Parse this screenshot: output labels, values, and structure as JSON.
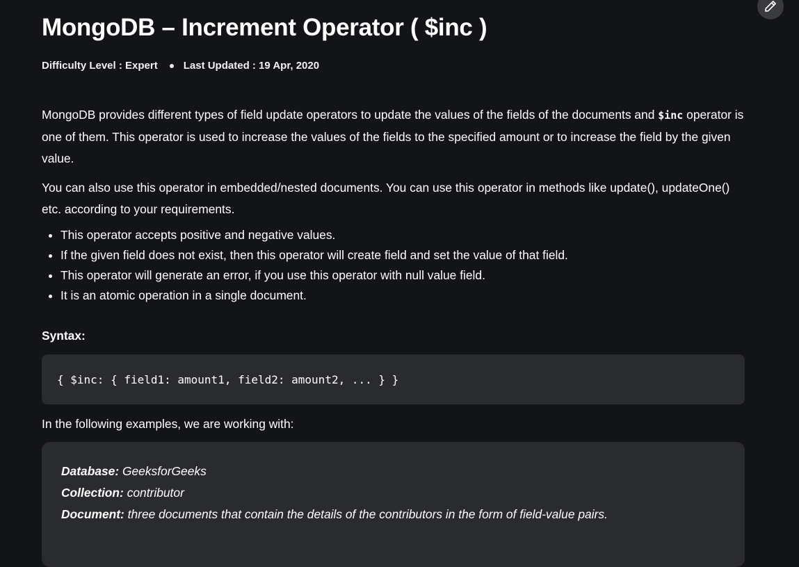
{
  "article": {
    "title": "MongoDB – Increment Operator ( $inc )",
    "difficulty": "Difficulty Level : Expert",
    "last_updated": "Last Updated : 19 Apr, 2020",
    "intro_before_code": "MongoDB provides different types of field update operators to update the values of the fields of the documents and ",
    "intro_code": "$inc",
    "intro_after_code": " operator is one of them. This operator is used to increase the values of the fields to the specified amount or to increase the field by the given value.",
    "paragraph2": "You can also use this operator in embedded/nested documents. You can use this operator in methods like update(), updateOne() etc. according to your requirements.",
    "bullets": [
      "This operator accepts positive and negative values.",
      "If the given field does not exist, then this operator will create field and set the value of that field.",
      "This operator will generate an error, if you use this operator with null value field.",
      "It is an atomic operation in a single document."
    ],
    "syntax_label": "Syntax:",
    "syntax_code": "{ $inc: { field1: amount1, field2: amount2, ... } }",
    "following": "In the following examples, we are working with:",
    "info": {
      "database_label": "Database:",
      "database_value": " GeeksforGeeks",
      "collection_label": "Collection:",
      "collection_value": " contributor",
      "document_label": "Document:",
      "document_value": " three documents that contain the details of the contributors in the form of field-value pairs."
    }
  },
  "icons": {
    "edit": "pencil-icon"
  },
  "colors": {
    "background": "#131418",
    "code_box": "#2a2b2f",
    "edit_button": "#3a3b40",
    "text": "#ffffff"
  }
}
